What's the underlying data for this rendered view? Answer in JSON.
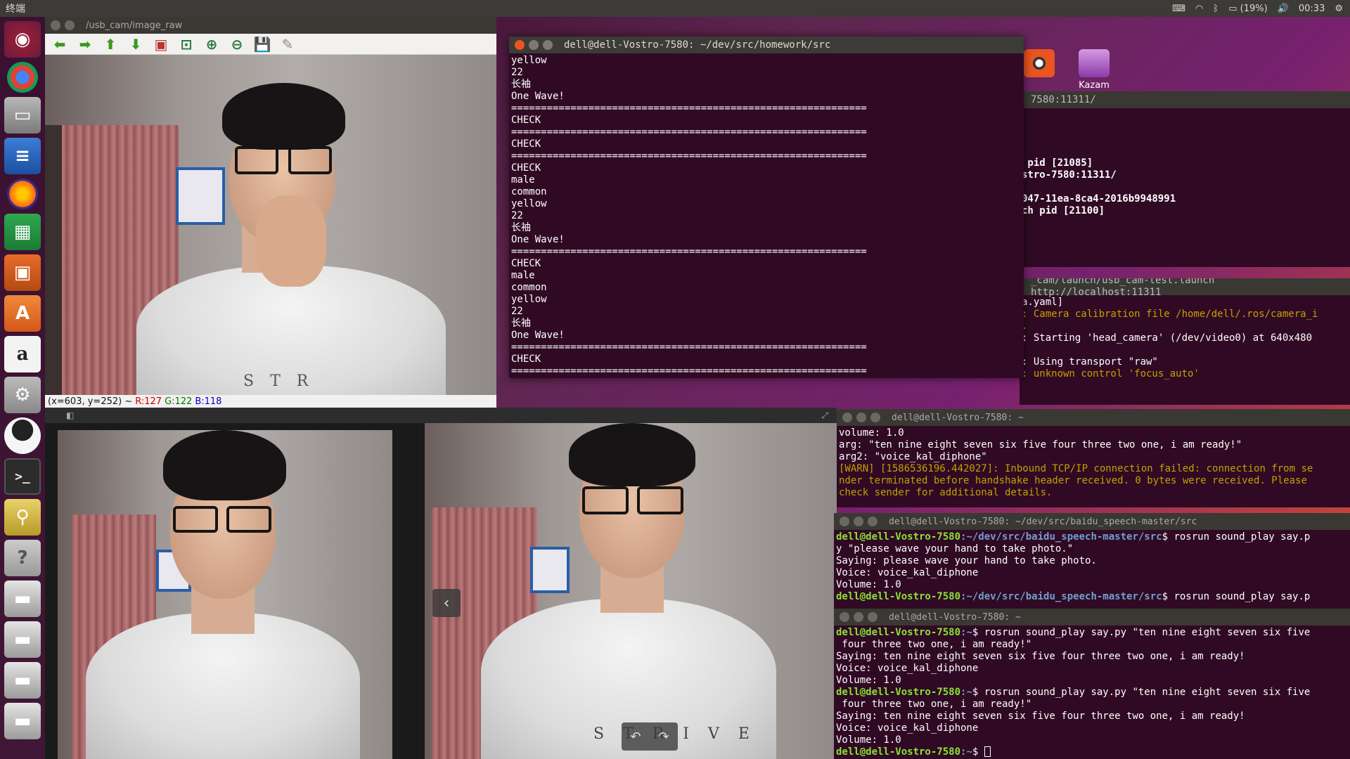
{
  "top_panel": {
    "app_title": "终端",
    "battery": "(19%)",
    "time": "00:33"
  },
  "launcher": {
    "items": [
      {
        "name": "dash",
        "glyph": "◉"
      },
      {
        "name": "chrome",
        "glyph": ""
      },
      {
        "name": "files",
        "glyph": "▭"
      },
      {
        "name": "writer",
        "glyph": "≡"
      },
      {
        "name": "firefox",
        "glyph": ""
      },
      {
        "name": "calc",
        "glyph": "▦"
      },
      {
        "name": "impress",
        "glyph": "▣"
      },
      {
        "name": "software-center",
        "glyph": "A"
      },
      {
        "name": "amazon",
        "glyph": "a"
      },
      {
        "name": "system-settings",
        "glyph": "⚙"
      },
      {
        "name": "qq",
        "glyph": ""
      },
      {
        "name": "terminal",
        "glyph": ">_"
      },
      {
        "name": "image-search",
        "glyph": "⚲"
      },
      {
        "name": "help",
        "glyph": "?"
      },
      {
        "name": "drive-1",
        "glyph": "▬"
      },
      {
        "name": "drive-2",
        "glyph": "▬"
      },
      {
        "name": "drive-3",
        "glyph": "▬"
      },
      {
        "name": "drive-4",
        "glyph": "▬"
      }
    ]
  },
  "image_view": {
    "title": "/usb_cam/image_raw",
    "toolbar_icons": [
      "arrow-left",
      "arrow-right",
      "arrow-up",
      "arrow-down",
      "image",
      "zoom-fit",
      "zoom-in",
      "zoom-out",
      "save",
      "brush"
    ],
    "status": {
      "coords": "(x=603, y=252) ~",
      "r": "R:127",
      "g": "G:122",
      "b": "B:118"
    },
    "shirt_text": "S T R"
  },
  "viewer": {
    "filename_hint": "ge_body.png",
    "shirt_text_right": "S T R I V E"
  },
  "desktop_icons": [
    {
      "label": ""
    },
    {
      "label": "Kazam"
    }
  ],
  "terminal_main": {
    "title": "dell@dell-Vostro-7580: ~/dev/src/homework/src",
    "lines": [
      "yellow",
      "22",
      "长袖",
      "One Wave!",
      "============================================================",
      "CHECK",
      "============================================================",
      "CHECK",
      "============================================================",
      "CHECK",
      "male",
      "common",
      "yellow",
      "22",
      "长袖",
      "One Wave!",
      "============================================================",
      "CHECK",
      "male",
      "common",
      "yellow",
      "22",
      "长袖",
      "One Wave!",
      "============================================================",
      "CHECK",
      "============================================================"
    ]
  },
  "terminal_bg1": {
    "title": "7580:11311/",
    "lines": [
      "",
      "",
      "",
      "",
      " pid [21085]",
      "stro-7580:11311/",
      "",
      "047-11ea-8ca4-2016b9948991",
      "ch pid [21100]"
    ]
  },
  "terminal_bg2": {
    "title": "_cam/launch/usb_cam-test.launch http://localhost:11311",
    "lines": [
      "a.yaml]",
      ": Camera calibration file /home/dell/.ros/camera_i",
      ".",
      ": Starting 'head_camera' (/dev/video0) at 640x480",
      "",
      ": Using transport \"raw\"",
      ": unknown control 'focus_auto'"
    ]
  },
  "terminal_small1": {
    "title": "dell@dell-Vostro-7580: ~",
    "lines": [
      "volume: 1.0",
      "arg: \"ten nine eight seven six five four three two one, i am ready!\"",
      "arg2: \"voice_kal_diphone\"",
      "[WARN] [1586536196.442027]: Inbound TCP/IP connection failed: connection from se",
      "nder terminated before handshake header received. 0 bytes were received. Please",
      "check sender for additional details."
    ]
  },
  "terminal_small2": {
    "title": "dell@dell-Vostro-7580: ~/dev/src/baidu_speech-master/src",
    "prompt_user": "dell@dell-Vostro-7580",
    "prompt_path": ":~/dev/src/baidu_speech-master/src",
    "cmd1": "$ rosrun sound_play say.p",
    "cmd1_wrap": "y \"please wave your hand to take photo.\"",
    "out1": "Saying: please wave your hand to take photo.",
    "out2": "Voice: voice_kal_diphone",
    "out3": "Volume: 1.0",
    "cmd2": "$ rosrun sound_play say.p"
  },
  "terminal_small3": {
    "title": "dell@dell-Vostro-7580: ~",
    "prompt_user": "dell@dell-Vostro-7580",
    "prompt_path": ":~",
    "cmd1": "$ rosrun sound_play say.py \"ten nine eight seven six five",
    "cmd1_wrap": " four three two one, i am ready!\"",
    "out1": "Saying: ten nine eight seven six five four three two one, i am ready!",
    "out2": "Voice: voice_kal_diphone",
    "out3": "Volume: 1.0",
    "cmd2": "$ rosrun sound_play say.py \"ten nine eight seven six five",
    "cmd2_wrap": " four three two one, i am ready!\"",
    "out4": "Saying: ten nine eight seven six five four three two one, i am ready!",
    "out5": "Voice: voice_kal_diphone",
    "out6": "Volume: 1.0",
    "final_prompt": "$ "
  }
}
